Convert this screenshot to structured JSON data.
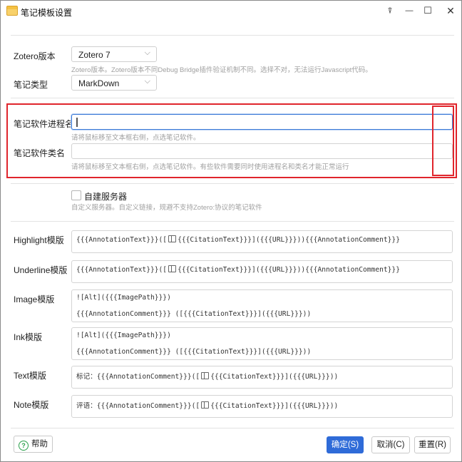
{
  "background_text": "...",
  "window": {
    "title": "笔记模板设置",
    "pin_glyph": "⍒",
    "minimize_glyph": "—",
    "maximize_glyph": "☐",
    "close_glyph": "✕"
  },
  "zotero_version": {
    "label": "Zotero版本",
    "value": "Zotero 7",
    "hint": "Zotero版本。Zotero版本不同Debug Bridge插件验证机制不同。选择不对，无法运行Javascript代码。"
  },
  "note_type": {
    "label": "笔记类型",
    "value": "MarkDown"
  },
  "process_name": {
    "label": "笔记软件进程名",
    "value": "",
    "hint": "请将鼠标移至文本框右侧，点选笔记软件。"
  },
  "class_name": {
    "label": "笔记软件类名",
    "value": "",
    "hint": "请将鼠标移至文本框右侧，点选笔记软件。有些软件需要同时使用进程名和类名才能正常运行"
  },
  "self_server": {
    "label": "自建服务器",
    "checked": false,
    "hint": "自定义服务器。自定义链接，规避不支持Zotero:协议的笔记软件"
  },
  "templates": {
    "highlight": {
      "label": "Highlight模版",
      "pre": "{{{AnnotationText}}}([",
      "post": "{{{CitationText}}}]({{{URL}}})){{{AnnotationComment}}}"
    },
    "underline": {
      "label": "Underline模版",
      "pre": "{{{AnnotationText}}}([",
      "post": "{{{CitationText}}}]({{{URL}}})){{{AnnotationComment}}}"
    },
    "image": {
      "label": "Image模版",
      "line1": "![Alt]({{{ImagePath}}})",
      "line2": "{{{AnnotationComment}}} ([{{{CitationText}}}]({{{URL}}}))"
    },
    "ink": {
      "label": "Ink模版",
      "line1": "![Alt]({{{ImagePath}}})",
      "line2": "{{{AnnotationComment}}} ([{{{CitationText}}}]({{{URL}}}))"
    },
    "text": {
      "label": "Text模版",
      "pre": "标记：{{{AnnotationComment}}}([",
      "post": "{{{CitationText}}}]({{{URL}}}))"
    },
    "note": {
      "label": "Note模版",
      "pre": "评语：{{{AnnotationComment}}}([",
      "post": "{{{CitationText}}}]({{{URL}}}))"
    }
  },
  "buttons": {
    "help": "帮助",
    "ok": "确定(S)",
    "cancel": "取消(C)",
    "reset": "重置(R)"
  },
  "colors": {
    "accent": "#2f6bd8",
    "highlight_box": "#e0252c",
    "help": "#2aa04a"
  }
}
